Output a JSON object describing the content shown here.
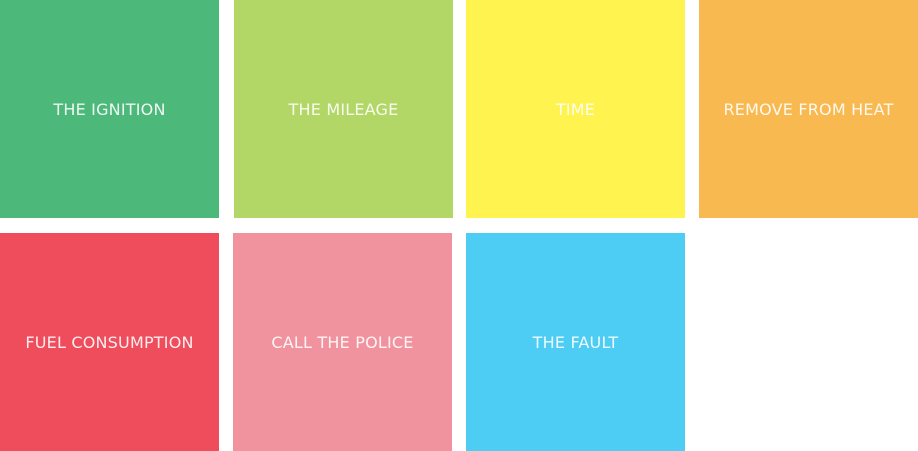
{
  "tiles": [
    {
      "label": "THE IGNITION",
      "color": "#4cb97b"
    },
    {
      "label": "THE MILEAGE",
      "color": "#b2d766"
    },
    {
      "label": "TIME",
      "color": "#fff34f"
    },
    {
      "label": "REMOVE FROM HEAT",
      "color": "#f8b950"
    },
    {
      "label": "FUEL CONSUMPTION",
      "color": "#ef4c5c"
    },
    {
      "label": "CALL THE POLICE",
      "color": "#f1939e"
    },
    {
      "label": "THE FAULT",
      "color": "#4dcdf4"
    }
  ]
}
